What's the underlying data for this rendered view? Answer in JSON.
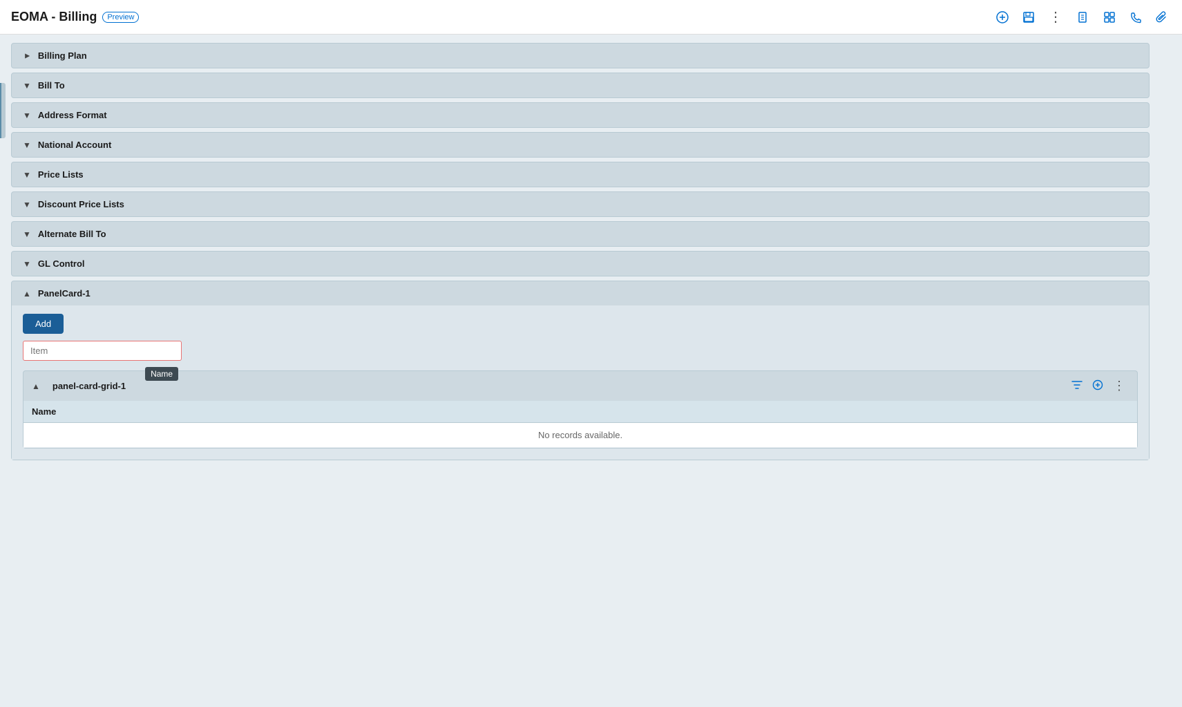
{
  "header": {
    "title": "EOMA - Billing",
    "preview_label": "Preview",
    "icons": {
      "add": "+",
      "save": "💾",
      "more": "⋮",
      "doc": "📄",
      "layout": "⊞",
      "phone": "📞",
      "clip": "📎"
    }
  },
  "sections": [
    {
      "id": "billing-plan",
      "label": "Billing Plan",
      "collapsed": true
    },
    {
      "id": "bill-to",
      "label": "Bill To",
      "collapsed": true
    },
    {
      "id": "address-format",
      "label": "Address Format",
      "collapsed": true
    },
    {
      "id": "national-account",
      "label": "National Account",
      "collapsed": true
    },
    {
      "id": "price-lists",
      "label": "Price Lists",
      "collapsed": true
    },
    {
      "id": "discount-price-lists",
      "label": "Discount Price Lists",
      "collapsed": true
    },
    {
      "id": "alternate-bill-to",
      "label": "Alternate Bill To",
      "collapsed": true
    },
    {
      "id": "gl-control",
      "label": "GL Control",
      "collapsed": true
    },
    {
      "id": "panel-card-1",
      "label": "PanelCard-1",
      "collapsed": false
    }
  ],
  "panel_card_1": {
    "add_button_label": "Add",
    "item_input_placeholder": "Item",
    "sub_panel": {
      "label": "panel-card-grid-1",
      "tooltip": "Name",
      "table": {
        "columns": [
          "Name"
        ],
        "empty_message": "No records available."
      },
      "icons": {
        "filter": "filter",
        "add": "add",
        "more": "more"
      }
    }
  }
}
